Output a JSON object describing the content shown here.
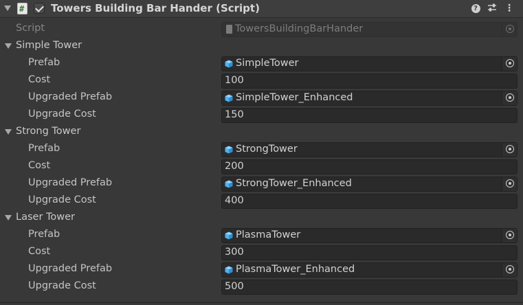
{
  "header": {
    "title": "Towers Building Bar Hander (Script)",
    "enabled": true,
    "icons": [
      "fold-arrow-icon",
      "script-icon",
      "checkbox-icon",
      "help-icon",
      "preset-icon",
      "menu-icon"
    ]
  },
  "script_field": {
    "label": "Script",
    "value": "TowersBuildingBarHander"
  },
  "groups": [
    {
      "name": "Simple Tower",
      "prefab_label": "Prefab",
      "prefab": "SimpleTower",
      "cost_label": "Cost",
      "cost": "100",
      "upgraded_prefab_label": "Upgraded Prefab",
      "upgraded_prefab": "SimpleTower_Enhanced",
      "upgrade_cost_label": "Upgrade Cost",
      "upgrade_cost": "150"
    },
    {
      "name": "Strong Tower",
      "prefab_label": "Prefab",
      "prefab": "StrongTower",
      "cost_label": "Cost",
      "cost": "200",
      "upgraded_prefab_label": "Upgraded Prefab",
      "upgraded_prefab": "StrongTower_Enhanced",
      "upgrade_cost_label": "Upgrade Cost",
      "upgrade_cost": "400"
    },
    {
      "name": "Laser Tower",
      "prefab_label": "Prefab",
      "prefab": "PlasmaTower",
      "cost_label": "Cost",
      "cost": "300",
      "upgraded_prefab_label": "Upgraded Prefab",
      "upgraded_prefab": "PlasmaTower_Enhanced",
      "upgrade_cost_label": "Upgrade Cost",
      "upgrade_cost": "500"
    }
  ],
  "colors": {
    "panel_bg": "#383838",
    "field_bg": "#2a2a2a",
    "prefab_icon": "#4fb3f0"
  }
}
